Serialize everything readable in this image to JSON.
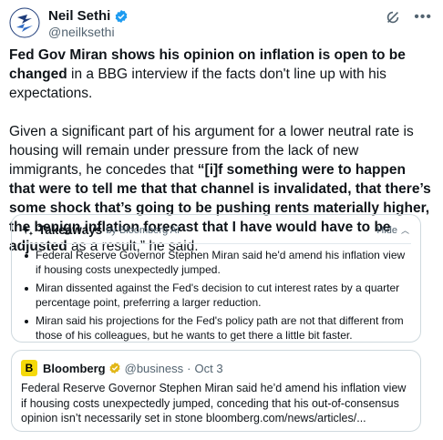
{
  "author": {
    "name": "Neil Sethi",
    "handle": "@neilksethi"
  },
  "tweet": {
    "p1_bold": "Fed Gov Miran shows his opinion on inflation is open to be changed",
    "p1_rest": " in a BBG interview if the facts don't line up with his expectations.",
    "p2_start": "Given a significant part of his argument for a lower neutral rate is housing will remain under pressure from the lack of new immigrants, he concedes that ",
    "p2_bold": "“[i]f something were to happen that were to tell me that that channel is invalidated, that there’s some shock that’s going to be pushing rents materially higher, the benign inflation forecast that I have would have to be adjusted",
    "p2_end": " as a result,” he said."
  },
  "takeaways": {
    "title": "Takeaways",
    "by": "by Bloomberg AI",
    "hide_label": "Hide",
    "items": [
      "Federal Reserve Governor Stephen Miran said he'd amend his inflation view if housing costs unexpectedly jumped.",
      "Miran dissented against the Fed's decision to cut interest rates by a quarter percentage point, preferring a larger reduction.",
      "Miran said his projections for the Fed's policy path are not that different from those of his colleagues, but he wants to get there a little bit faster."
    ]
  },
  "quote": {
    "logo_letter": "B",
    "name": "Bloomberg",
    "handle": "@business",
    "dot": "·",
    "date": "Oct 3",
    "text": "Federal Reserve Governor Stephen Miran said he’d amend his inflation view if housing costs unexpectedly jumped, conceding that his out-of-consensus opinion isn’t necessarily set in stone bloomberg.com/news/articles/..."
  },
  "icons": {
    "verified": "verified-badge-icon",
    "grok": "grok-icon",
    "more": "more-icon",
    "sparkle": "sparkle-icon"
  },
  "colors": {
    "verified_blue": "#1d9bf0",
    "bloomberg_yellow": "#f5d90a",
    "gold_check": "#e2b719"
  }
}
